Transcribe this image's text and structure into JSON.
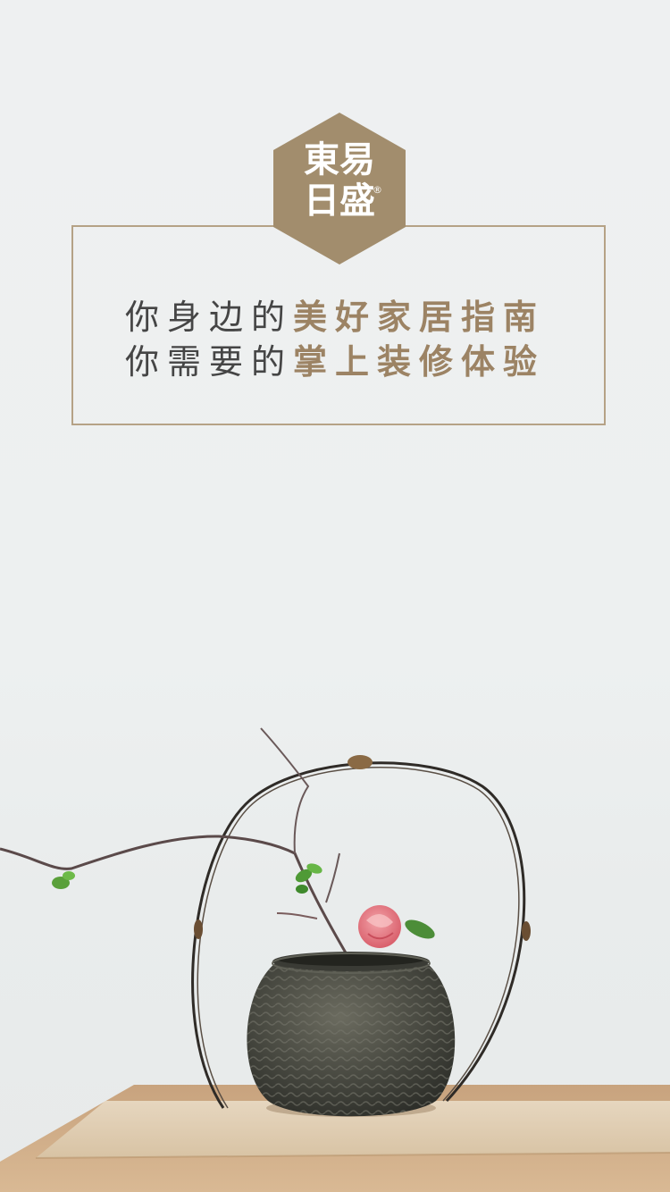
{
  "brand": {
    "line1": "東易",
    "line2": "日盛",
    "registered_mark": "®",
    "color": "#a28d6d"
  },
  "slogan": {
    "line1_plain": "你身边的",
    "line1_accent": "美好家居指南",
    "line2_plain": "你需要的",
    "line2_accent": "掌上装修体验"
  },
  "colors": {
    "background": "#eef0f0",
    "accent": "#9c8364",
    "frame_border": "#b5a286",
    "text_dark": "#454545"
  },
  "illustration": {
    "subject": "woven-basket-with-camellia",
    "icons": [
      "basket-icon",
      "flower-icon",
      "branch-icon",
      "table-icon"
    ]
  }
}
